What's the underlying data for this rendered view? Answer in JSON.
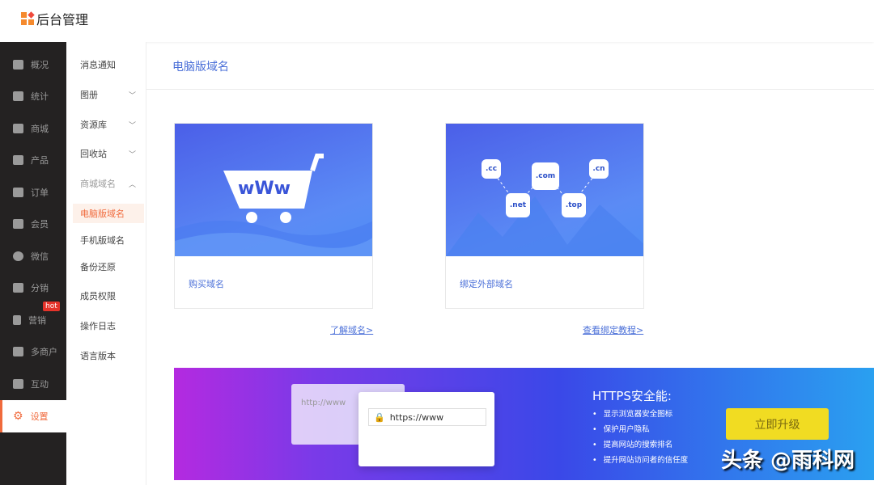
{
  "header": {
    "title": "后台管理"
  },
  "sidebar": {
    "items": [
      {
        "label": "概况",
        "icon": "layers-icon"
      },
      {
        "label": "统计",
        "icon": "chart-icon"
      },
      {
        "label": "商城",
        "icon": "store-icon"
      },
      {
        "label": "产品",
        "icon": "grid-icon"
      },
      {
        "label": "订单",
        "icon": "clipboard-icon"
      },
      {
        "label": "会员",
        "icon": "crown-icon"
      },
      {
        "label": "微信",
        "icon": "wechat-icon"
      },
      {
        "label": "分销",
        "icon": "users-icon"
      },
      {
        "label": "营销",
        "icon": "flag-icon",
        "badge": "hot"
      },
      {
        "label": "多商户",
        "icon": "shop-icon"
      },
      {
        "label": "互动",
        "icon": "apps-icon"
      },
      {
        "label": "设置",
        "icon": "gear-icon",
        "active": true
      }
    ]
  },
  "submenu": {
    "items": [
      {
        "label": "消息通知"
      },
      {
        "label": "图册",
        "chevron": "down"
      },
      {
        "label": "资源库",
        "chevron": "down"
      },
      {
        "label": "回收站",
        "chevron": "down"
      },
      {
        "label": "商城域名",
        "chevron": "up"
      },
      {
        "label": "电脑版域名",
        "active": true
      },
      {
        "label": "手机版域名"
      },
      {
        "label": "备份还原"
      },
      {
        "label": "成员权限"
      },
      {
        "label": "操作日志"
      },
      {
        "label": "语言版本"
      }
    ]
  },
  "main": {
    "title": "电脑版域名",
    "cards": [
      {
        "label": "购买域名",
        "img_text": "wWw",
        "link": "了解域名>"
      },
      {
        "label": "绑定外部域名",
        "domains": [
          ".cc",
          ".com",
          ".cn",
          ".net",
          ".top"
        ],
        "link": "查看绑定教程>"
      }
    ],
    "banner": {
      "title": "HTTPS安全能:",
      "features": [
        "显示浏览器安全图标",
        "保护用户隐私",
        "提高网站的搜索排名",
        "提升网站访问者的信任度"
      ],
      "button": "立即升级",
      "url_http": "http://www",
      "url_https": "https://www",
      "watermark": "头条 @雨科网"
    }
  },
  "colors": {
    "accent": "#f06a3c",
    "link": "#4a6fd8",
    "sidebar": "#242222",
    "button": "#f1dc22"
  }
}
